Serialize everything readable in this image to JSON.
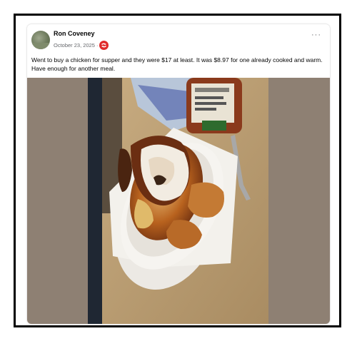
{
  "post": {
    "author": "Ron Coveney",
    "date": "October 23, 2025",
    "separator": "·",
    "more_label": "···",
    "text": "Went to buy a chicken for supper and they were $17 at least. It was $8.97 for one already cooked and warm. Have enough for another meal."
  },
  "icons": {
    "avatar": "profile-photo",
    "privacy": "red-circle-badge-icon",
    "more": "ellipsis-icon"
  },
  "colors": {
    "side_fill": "#8e8073",
    "counter": "#c4a77a",
    "badge": "#e02b2b"
  }
}
